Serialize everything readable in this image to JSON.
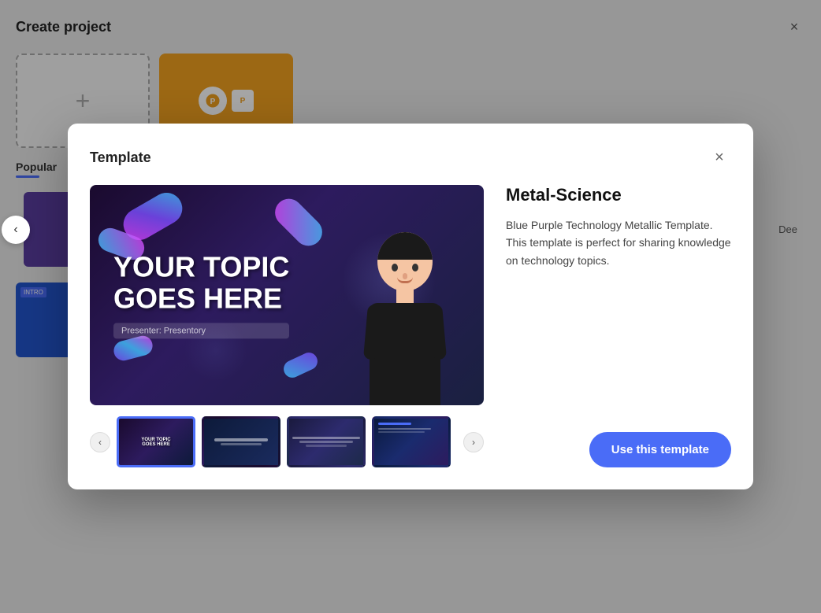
{
  "background": {
    "title": "Create project",
    "close_label": "×",
    "new_card_icon": "+",
    "section_label": "Popular",
    "underline_color": "#4a6cf7"
  },
  "modal": {
    "title": "Template",
    "close_label": "×"
  },
  "preview": {
    "heading_line1": "YOUR TOPIC",
    "heading_line2": "GOES HERE",
    "presenter_label": "Presenter: Presentory"
  },
  "template": {
    "name": "Metal-Science",
    "description": "Blue Purple Technology Metallic Template. This template is perfect for sharing knowledge on technology topics."
  },
  "thumbnails": [
    {
      "id": 1,
      "label": "YOUR TOPIC GOES HERE",
      "active": true
    },
    {
      "id": 2,
      "label": "",
      "active": false
    },
    {
      "id": 3,
      "label": "",
      "active": false
    },
    {
      "id": 4,
      "label": "",
      "active": false
    },
    {
      "id": 5,
      "label": "",
      "active": false
    }
  ],
  "buttons": {
    "prev_thumb": "‹",
    "next_thumb": "›",
    "prev_carousel": "‹",
    "use_template": "Use this template"
  }
}
